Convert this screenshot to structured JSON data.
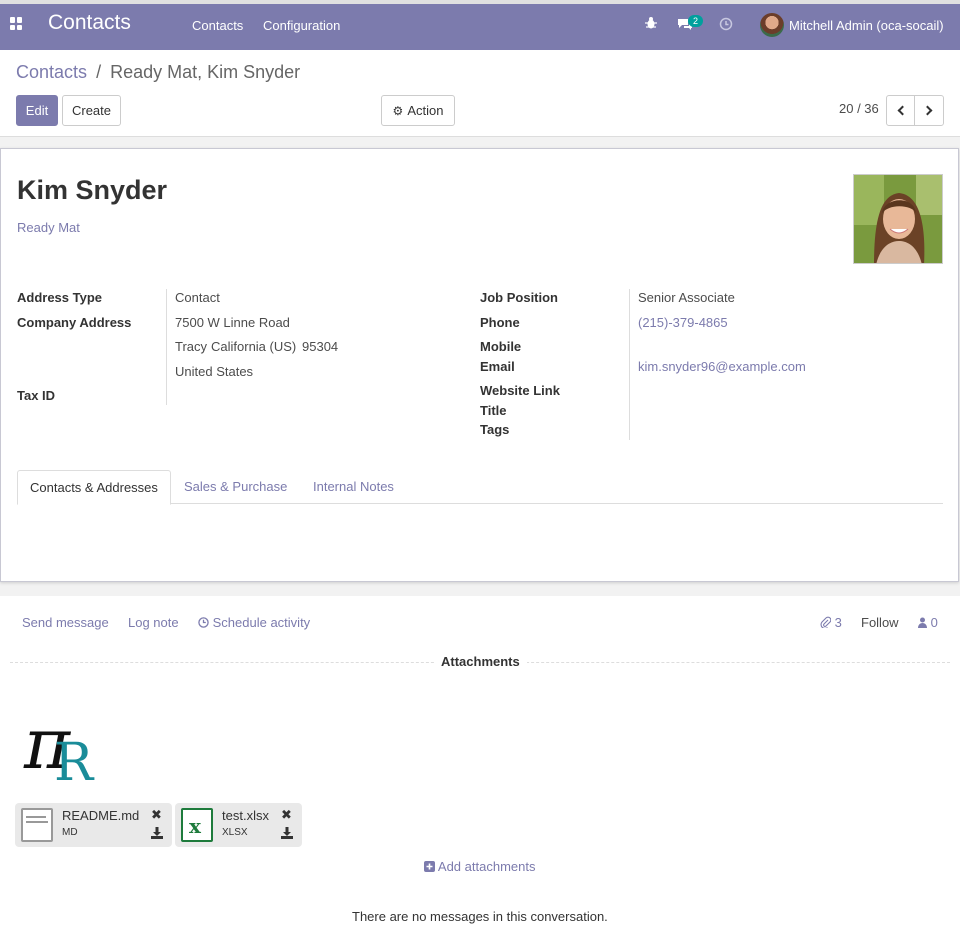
{
  "navbar": {
    "brand": "Contacts",
    "menu": [
      "Contacts",
      "Configuration"
    ],
    "messages_count": "2",
    "user_name": "Mitchell Admin (oca-socail)"
  },
  "breadcrumb": {
    "parent": "Contacts",
    "separator": "/",
    "current": "Ready Mat, Kim Snyder"
  },
  "buttons": {
    "edit": "Edit",
    "create": "Create",
    "action": "Action"
  },
  "pager": {
    "value": "20 / 36"
  },
  "partner": {
    "name": "Kim Snyder",
    "company": "Ready Mat"
  },
  "left_fields": {
    "address_type_label": "Address Type",
    "address_type_value": "Contact",
    "company_address_label": "Company Address",
    "street": "7500 W Linne Road",
    "city": "Tracy",
    "state": "California (US)",
    "zip": "95304",
    "country": "United States",
    "tax_id_label": "Tax ID"
  },
  "right_fields": {
    "job_position_label": "Job Position",
    "job_position_value": "Senior Associate",
    "phone_label": "Phone",
    "phone_value": "(215)-379-4865",
    "mobile_label": "Mobile",
    "email_label": "Email",
    "email_value": "kim.snyder96@example.com",
    "website_label": "Website Link",
    "title_label": "Title",
    "tags_label": "Tags"
  },
  "tabs": [
    "Contacts & Addresses",
    "Sales & Purchase",
    "Internal Notes"
  ],
  "chatter": {
    "send_message": "Send message",
    "log_note": "Log note",
    "schedule_activity": "Schedule activity",
    "attachment_count": "3",
    "follow": "Follow",
    "followers_count": "0",
    "attachments_title": "Attachments",
    "add_attachments": "Add attachments",
    "no_messages": "There are no messages in this conversation."
  },
  "attachments": [
    {
      "name": "README.md",
      "ext": "MD"
    },
    {
      "name": "test.xlsx",
      "ext": "XLSX"
    }
  ],
  "colors": {
    "brand": "#7c7bad",
    "badge": "#00a09d"
  }
}
